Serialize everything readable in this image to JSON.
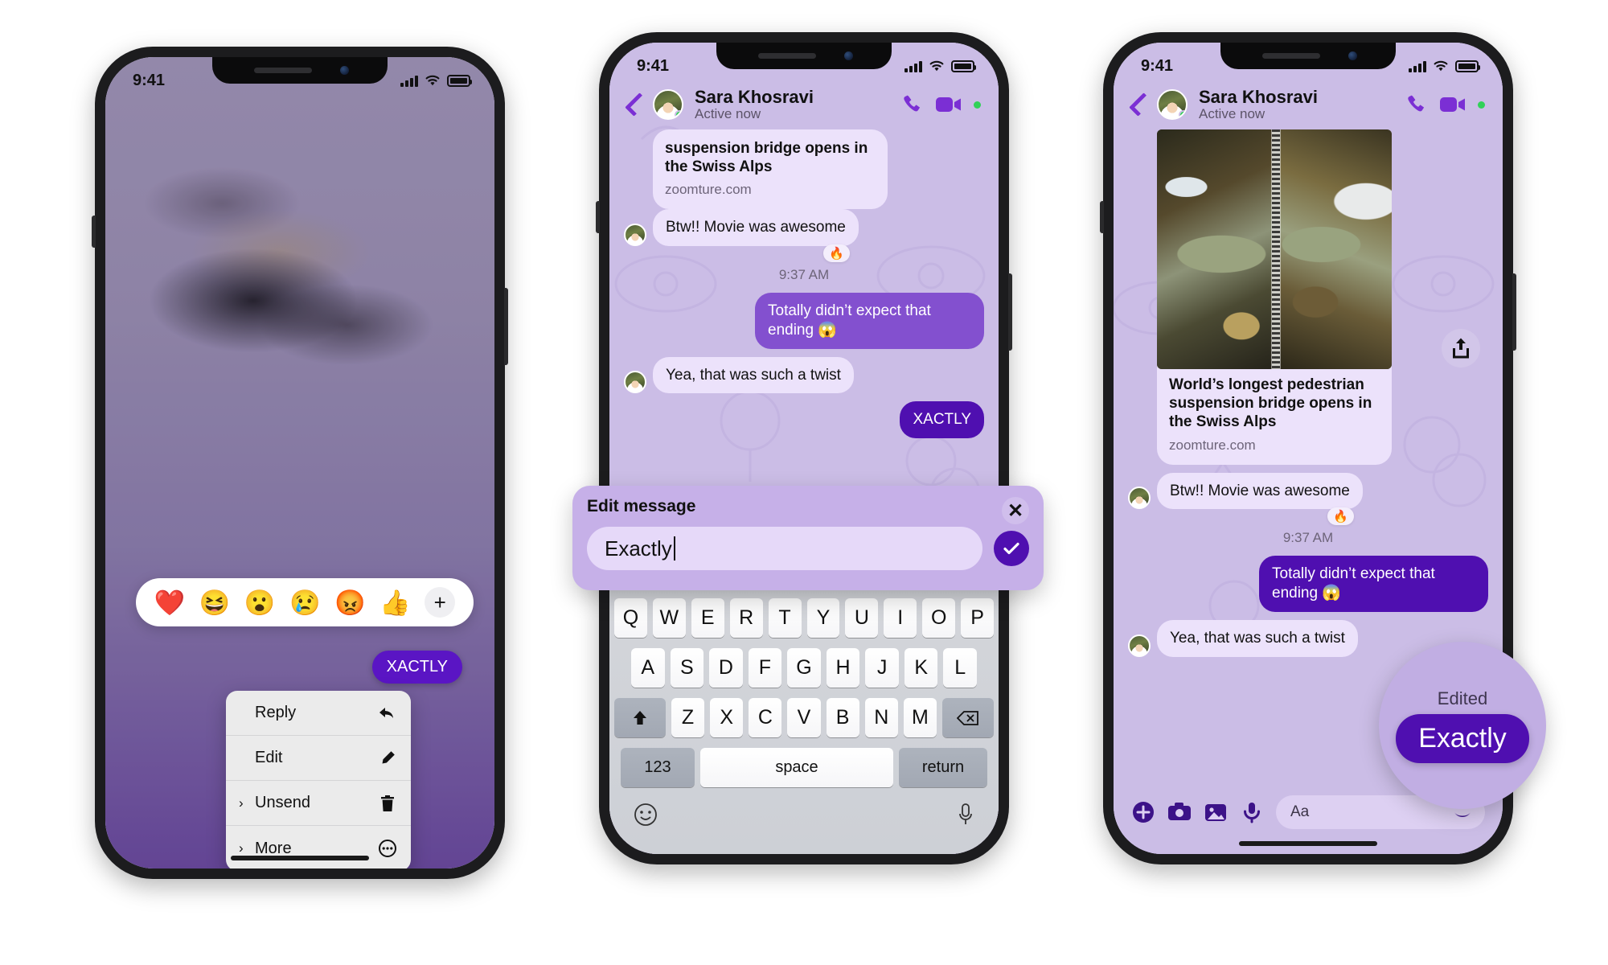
{
  "status_bar": {
    "time": "9:41",
    "signal": "signal-bars",
    "wifi": "wifi",
    "battery": "battery-full"
  },
  "contact": {
    "name": "Sara Khosravi",
    "status": "Active now"
  },
  "phone1": {
    "reactions": [
      "❤️",
      "😆",
      "😮",
      "😢",
      "😡",
      "👍"
    ],
    "add_reaction_label": "+",
    "menu": [
      {
        "label": "Reply",
        "icon": "reply-arrow-icon",
        "chevron": ""
      },
      {
        "label": "Edit",
        "icon": "pencil-icon",
        "chevron": ""
      },
      {
        "label": "Unsend",
        "icon": "trash-icon",
        "chevron": "›"
      },
      {
        "label": "More",
        "icon": "ellipsis-circle-icon",
        "chevron": "›"
      }
    ],
    "highlighted_message": "XACTLY"
  },
  "phone2": {
    "messages": [
      {
        "type": "link_card",
        "title": "suspension bridge opens in the Swiss Alps",
        "url": "zoomture.com",
        "side": "in"
      },
      {
        "type": "text",
        "text": "Btw!! Movie was awesome",
        "side": "in",
        "reaction": "🔥"
      },
      {
        "type": "time",
        "text": "9:37 AM"
      },
      {
        "type": "text",
        "text": "Totally didn’t expect that ending 😱",
        "side": "out"
      },
      {
        "type": "text",
        "text": "Yea, that was such a twist",
        "side": "in"
      },
      {
        "type": "text",
        "text": "XACTLY",
        "side": "out-deep"
      }
    ],
    "edit_dialog": {
      "title": "Edit message",
      "value": "Exactly",
      "close_label": "✕",
      "confirm_label": "✓"
    },
    "keyboard": {
      "row1": [
        "Q",
        "W",
        "E",
        "R",
        "T",
        "Y",
        "U",
        "I",
        "O",
        "P"
      ],
      "row2": [
        "A",
        "S",
        "D",
        "F",
        "G",
        "H",
        "J",
        "K",
        "L"
      ],
      "row3": [
        "Z",
        "X",
        "C",
        "V",
        "B",
        "N",
        "M"
      ],
      "shift": "shift-icon",
      "backspace": "backspace-icon",
      "numbers": "123",
      "space": "space",
      "return": "return",
      "emoji_key": "emoji-icon",
      "mic_key": "microphone-icon"
    }
  },
  "phone3": {
    "photo_alt": "aerial-photo-canyon-bridge",
    "share_icon": "share-icon",
    "messages": [
      {
        "type": "link_card",
        "title": "World’s longest pedestrian suspension bridge opens in the Swiss Alps",
        "url": "zoomture.com",
        "side": "in"
      },
      {
        "type": "text",
        "text": "Btw!! Movie was awesome",
        "side": "in",
        "reaction": "🔥"
      },
      {
        "type": "time",
        "text": "9:37 AM"
      },
      {
        "type": "text",
        "text": "Totally didn’t expect that ending 😱",
        "side": "out"
      },
      {
        "type": "text",
        "text": "Yea, that was such a twist",
        "side": "in"
      }
    ],
    "magnifier": {
      "label": "Edited",
      "message": "Exactly"
    },
    "composer": {
      "plus": "plus-circle-icon",
      "camera": "camera-icon",
      "gallery": "photo-icon",
      "mic": "microphone-icon",
      "placeholder": "Aa",
      "sticker": "sticker-icon"
    }
  },
  "colors": {
    "accent_purple": "#7b2fd4",
    "deep_purple": "#4f0fb0",
    "bubble_out": "#8350cf",
    "bubble_in": "#ece2fb",
    "wallpaper": "#cbbde6",
    "online_green": "#31d158"
  }
}
